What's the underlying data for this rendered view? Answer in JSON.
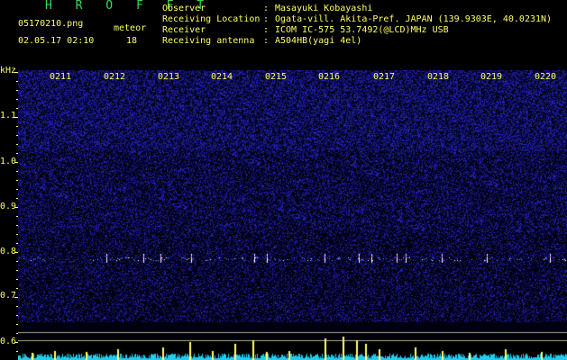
{
  "app_title": "H R O F F T",
  "file_name": "05170210.png",
  "meteor_label": "meteor",
  "datetime": "02.05.17 02:10",
  "meteor_count": "18",
  "info": {
    "observer_key": "Observer",
    "observer_val": "Masayuki Kobayashi",
    "location_key": "Receiving Location",
    "location_val": "Ogata-vill. Akita-Pref. JAPAN (139.9303E, 40.0231N)",
    "receiver_key": "Receiver",
    "receiver_val": "ICOM IC-575 53.7492(@LCD)MHz USB",
    "antenna_key": "Receiving antenna",
    "antenna_val": "A504HB(yagi 4el)",
    "colon": ":"
  },
  "axis": {
    "unit": "kHz",
    "labels": [
      "1.1",
      "1.0",
      "0.9",
      "0.8",
      "0.7",
      "0.6"
    ]
  },
  "time_labels": [
    "0211",
    "0212",
    "0213",
    "0214",
    "0215",
    "0216",
    "0217",
    "0218",
    "0219",
    "0220"
  ],
  "colors": {
    "text": "#ffff66",
    "title": "#33dd55",
    "noise": "#2222aa",
    "echo_line": "#ffffff",
    "graph": "#22ccee"
  }
}
